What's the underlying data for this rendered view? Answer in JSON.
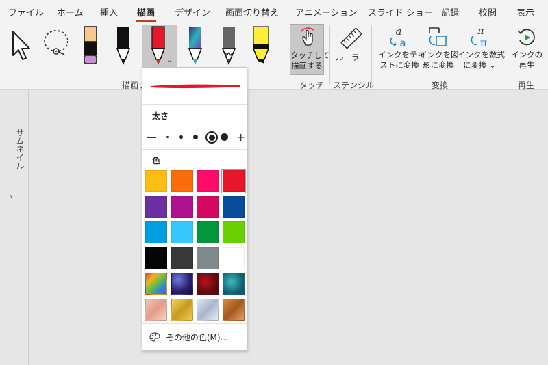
{
  "tabs": [
    "ファイル",
    "ホーム",
    "挿入",
    "描画",
    "デザイン",
    "画面切り替え",
    "アニメーション",
    "スライド ショー",
    "記録",
    "校閲",
    "表示"
  ],
  "active_tab": "描画",
  "ribbon": {
    "groups": {
      "draw": "描画ツール",
      "touch": "タッチ",
      "stencil": "ステンシル",
      "convert": "変換",
      "replay": "再生"
    },
    "touch_button": [
      "タッチして",
      "描画する"
    ],
    "ruler_button": "ルーラー",
    "ink_to_text": [
      "インクをテキ",
      "ストに変換"
    ],
    "ink_to_shape": [
      "インクを図",
      "形に変換"
    ],
    "ink_to_math": [
      "インクを数式",
      "に変換 ⌄"
    ],
    "ink_replay": [
      "インクの",
      "再生"
    ]
  },
  "pens": [
    {
      "name": "select-tool-icon",
      "kind": "cursor"
    },
    {
      "name": "lasso-select-icon",
      "kind": "lasso"
    },
    {
      "name": "eraser-icon",
      "kind": "eraser",
      "color": "#c88fd2"
    },
    {
      "name": "pen-black-icon",
      "kind": "pen",
      "color": "#111111"
    },
    {
      "name": "pen-red-icon",
      "kind": "pen",
      "color": "#e8162c",
      "selected": true
    },
    {
      "name": "pen-galaxy-icon",
      "kind": "pen",
      "color": "#2ab3b7"
    },
    {
      "name": "pencil-gray-icon",
      "kind": "pencil",
      "color": "#666666"
    },
    {
      "name": "highlighter-yellow-icon",
      "kind": "highlighter",
      "color": "#ffef3a"
    }
  ],
  "sidebar": {
    "thumbnails_label": "サムネイル"
  },
  "dropdown": {
    "preview_color": "#e8162c",
    "thickness_label": "太さ",
    "color_label": "色",
    "more_colors": "その他の色(M)...",
    "colors": [
      [
        "#fcbd15",
        "#f96d0b",
        "#ff0b6a",
        "#e8162c"
      ],
      [
        "#6a2fa0",
        "#b0118e",
        "#d5095f",
        "#084b9a"
      ],
      [
        "#009fe3",
        "#36c8fa",
        "#009639",
        "#6ad000"
      ],
      [
        "#050505",
        "#383838",
        "#7f8a8e",
        "#ffffff"
      ]
    ],
    "texture_names": [
      [
        "rainbow",
        "galaxy",
        "lava",
        "ocean"
      ],
      [
        "rose-gold",
        "gold",
        "silver",
        "bronze"
      ]
    ],
    "selected_color": "#e8162c"
  }
}
